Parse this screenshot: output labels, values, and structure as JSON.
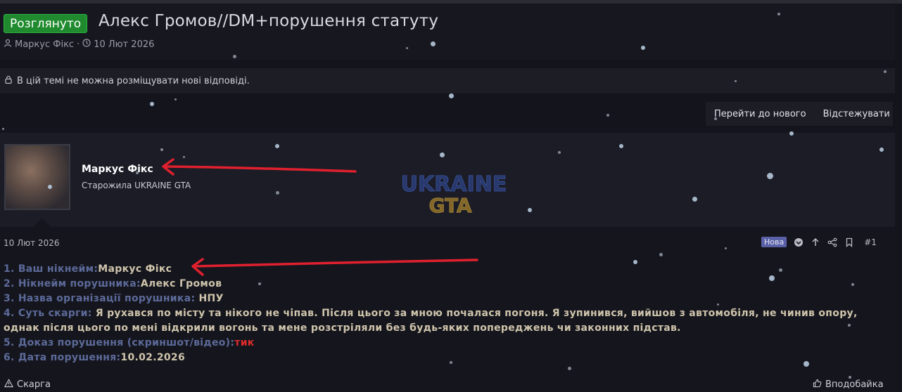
{
  "thread": {
    "prefix_tag": "Розглянуто",
    "title": "Алекс Громов//DM+порушення статуту",
    "author": "Маркус Фікс",
    "date": "10 Лют 2026"
  },
  "notice": {
    "locked_text": "В цій темі не можна розміщувати нові відповіді."
  },
  "thread_actions": {
    "go_to_new": "Перейти до нового",
    "watch": "Відстежувати"
  },
  "post": {
    "username": "Маркус Фікс",
    "user_title": "Старожила UKRAINE GTA",
    "date": "10 Лют 2026",
    "new_badge": "Нова",
    "post_number": "#1",
    "lines": [
      {
        "label": "1. Ваш нікнейм:",
        "value": "Маркус Фікс"
      },
      {
        "label": "2. Нікнейм порушника:",
        "value": "Алекс Громов"
      },
      {
        "label": "3. Назва організації порушника: ",
        "value": "НПУ"
      },
      {
        "label": "4. Суть скарги: ",
        "value": "Я рухався по місту та нікого не чіпав. Після цього за мною почалася погоня. Я зупинився, вийшов з автомобіля, не чинив опору, однак після цього по мені відкрили вогонь та мене розстріляли без будь-яких попереджень чи законних підстав."
      },
      {
        "label": "5. Доказ порушення (скриншот/відео):",
        "value": "тик"
      },
      {
        "label": "6. Дата порушення:",
        "value": "10.02.2026"
      }
    ],
    "report_label": "Скарга",
    "like_label": "Вподобайка"
  },
  "logo": {
    "line1": "UKRAINE",
    "line2": "GTA"
  },
  "colors": {
    "background": "#14151c",
    "tag_green": "#1f8a2e",
    "question_blue": "#5c6a9a",
    "answer_beige": "#cfc4ac",
    "evidence_red": "#e02a2a",
    "annotation_arrow": "#e0202e",
    "badge_new": "#5b61a8"
  },
  "icons": {
    "author": "user-icon",
    "date": "clock-icon",
    "lock": "lock-icon",
    "bookmark": "bookmark-icon",
    "share": "share-icon",
    "up": "arrow-up-icon",
    "react": "chevron-circle-icon",
    "report": "warning-icon",
    "like": "thumbs-up-icon"
  }
}
